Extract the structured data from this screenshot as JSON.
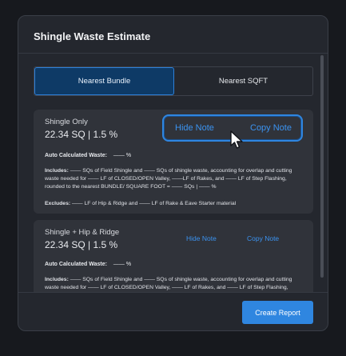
{
  "dialog": {
    "title": "Shingle Waste Estimate"
  },
  "tabs": [
    {
      "label": "Nearest Bundle",
      "active": true
    },
    {
      "label": "Nearest SQFT",
      "active": false
    }
  ],
  "cards": [
    {
      "title": "Shingle Only",
      "value": "22.34 SQ | 1.5 %",
      "hide_note": "Hide Note",
      "copy_note": "Copy Note",
      "auto_waste_label": "Auto Calculated Waste:",
      "auto_waste_value": "—— %",
      "includes_label": "Includes:",
      "includes_text": "—— SQs of Field Shingle and —— SQs of shingle waste, accounting for overlap and cutting waste needed for ——  LF of CLOSED/OPEN Valley, ——LF of Rakes, and —— LF of Step Flashing, rounded to the nearest BUNDLE/ SQUARE FOOT = —— SQs | —— %",
      "excludes_label": "Excludes:",
      "excludes_text": "—— LF of Hip & Ridge and  —— LF of Rake & Eave Starter material"
    },
    {
      "title": "Shingle + Hip & Ridge",
      "value": "22.34 SQ | 1.5 %",
      "hide_note": "Hide Note",
      "copy_note": "Copy Note",
      "auto_waste_label": "Auto Calculated Waste:",
      "auto_waste_value": "—— %",
      "includes_label": "Includes:",
      "includes_text": "—— SQs of Field Shingle and —— SQs of shingle waste, accounting for overlap and cutting waste needed for —— LF of CLOSED/OPEN Valley, —— LF of Rakes, and —— LF of Step Flashing, rounded to the nearest BUNDLE/ SQUARE FOOT = —— SQs | —— %"
    }
  ],
  "footer": {
    "create_report": "Create Report"
  },
  "colors": {
    "accent": "#2f86e0",
    "panel": "#24272e",
    "card": "#30333a"
  },
  "icons": {
    "cursor": "mouse-pointer-icon"
  }
}
